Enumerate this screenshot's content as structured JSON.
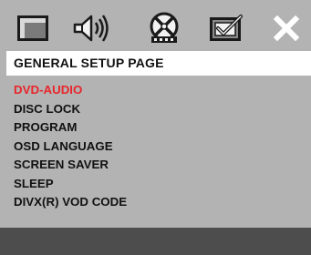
{
  "tabs": [
    {
      "icon": "general-setup-icon",
      "selected": true
    },
    {
      "icon": "audio-setup-icon",
      "selected": false
    },
    {
      "icon": "video-setup-icon",
      "selected": false
    },
    {
      "icon": "preference-setup-icon",
      "selected": false
    },
    {
      "icon": "close-icon",
      "selected": false
    }
  ],
  "header": {
    "title": "GENERAL SETUP PAGE"
  },
  "menu": {
    "items": [
      {
        "label": "DVD-AUDIO",
        "active": true
      },
      {
        "label": "DISC LOCK"
      },
      {
        "label": "PROGRAM"
      },
      {
        "label": "OSD LANGUAGE"
      },
      {
        "label": "SCREEN SAVER"
      },
      {
        "label": "SLEEP"
      },
      {
        "label": "DIVX(R) VOD CODE"
      }
    ]
  },
  "colors": {
    "panel": "#b3b3b3",
    "header_bg": "#ffffff",
    "active_item": "#e8262b",
    "text": "#111111",
    "footer": "#4d4d4d"
  }
}
